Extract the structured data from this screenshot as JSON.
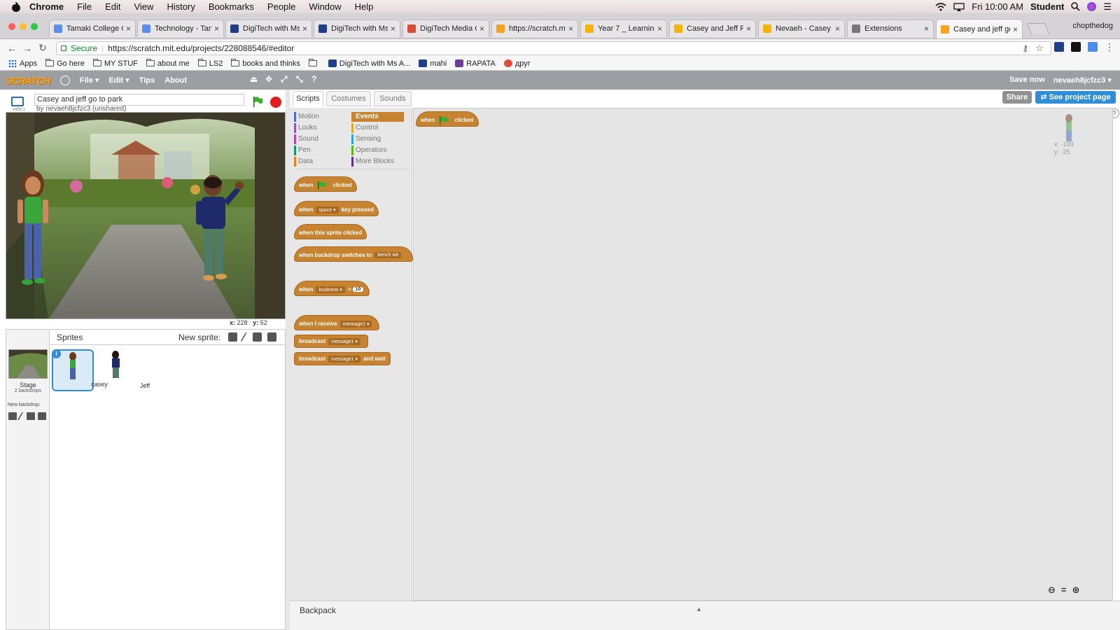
{
  "mac_menu": {
    "app": "Chrome",
    "items": [
      "File",
      "Edit",
      "View",
      "History",
      "Bookmarks",
      "People",
      "Window",
      "Help"
    ],
    "clock": "Fri 10:00 AM",
    "user": "Student"
  },
  "tabs": [
    {
      "title": "Tamaki College O",
      "fav": "#5b8def"
    },
    {
      "title": "Technology - Tam",
      "fav": "#5b8def"
    },
    {
      "title": "DigiTech with Ms",
      "fav": "#1f3f8a"
    },
    {
      "title": "DigiTech with Ms",
      "fav": "#1f3f8a"
    },
    {
      "title": "DigiTech Media O",
      "fav": "#dd4b39"
    },
    {
      "title": "https://scratch.m",
      "fav": "#f8a319"
    },
    {
      "title": "Year 7 _ Learning",
      "fav": "#f4b400"
    },
    {
      "title": "Casey and Jeff Pr",
      "fav": "#f4b400"
    },
    {
      "title": "Nevaeh - Casey a",
      "fav": "#f4b400"
    },
    {
      "title": "Extensions",
      "fav": "#777777"
    },
    {
      "title": "Casey and jeff go",
      "fav": "#f8a319"
    }
  ],
  "chrome_user": "chopthedog",
  "address": {
    "secure": "Secure",
    "url": "https://scratch.mit.edu/projects/228088546/#editor"
  },
  "bookmarks": [
    "Apps",
    "Go here",
    "MY STUF",
    "about me",
    "LS2",
    "books and thinks",
    "",
    "DigiTech with Ms A...",
    "mahi",
    "RAPATA",
    "друг"
  ],
  "scratch_menu": {
    "logo": "SCRATCH",
    "file": "File ▾",
    "edit": "Edit ▾",
    "tips": "Tips",
    "about": "About",
    "save_now": "Save now",
    "account": "nevaeh8jcfzc3 ▾"
  },
  "project": {
    "title": "Casey and jeff go to park",
    "author": "by nevaeh8jcfzc3 (unshared)",
    "version": "v459.1",
    "mouse_x_label": "x:",
    "mouse_x": "228",
    "mouse_y_label": "y:",
    "mouse_y": "52"
  },
  "sprites_panel": {
    "label": "Sprites",
    "new_sprite": "New sprite:",
    "stage_label": "Stage",
    "stage_sub": "2 backdrops",
    "new_backdrop": "New backdrop:",
    "sprites": [
      {
        "name": "casey"
      },
      {
        "name": "Jeff"
      }
    ]
  },
  "editor_tabs": [
    "Scripts",
    "Costumes",
    "Sounds"
  ],
  "share": "Share",
  "see_project": "See project page",
  "categories": [
    {
      "name": "Motion",
      "color": "#4a6cd4"
    },
    {
      "name": "Looks",
      "color": "#8a55d7"
    },
    {
      "name": "Sound",
      "color": "#bb42c3"
    },
    {
      "name": "Pen",
      "color": "#0e9a6c"
    },
    {
      "name": "Data",
      "color": "#ee7d16"
    },
    {
      "name": "Events",
      "color": "#c88330"
    },
    {
      "name": "Control",
      "color": "#e1a91a"
    },
    {
      "name": "Sensing",
      "color": "#2ca5e2"
    },
    {
      "name": "Operators",
      "color": "#5cb712"
    },
    {
      "name": "More Blocks",
      "color": "#632d99"
    }
  ],
  "blocks": {
    "when": "when",
    "clicked": "clicked",
    "key_pressed": "key pressed",
    "space": "space",
    "sprite_clicked": "when this sprite clicked",
    "backdrop_switches": "when backdrop switches to",
    "bench": "bench wit",
    "loudness": "loudness",
    "gt": ">",
    "ten": "10",
    "receive": "when I receive",
    "message1": "message1",
    "broadcast": "broadcast",
    "and_wait": "and wait"
  },
  "sprite_coords": {
    "x": "x: -199",
    "y": "y: -25"
  },
  "backpack": "Backpack"
}
